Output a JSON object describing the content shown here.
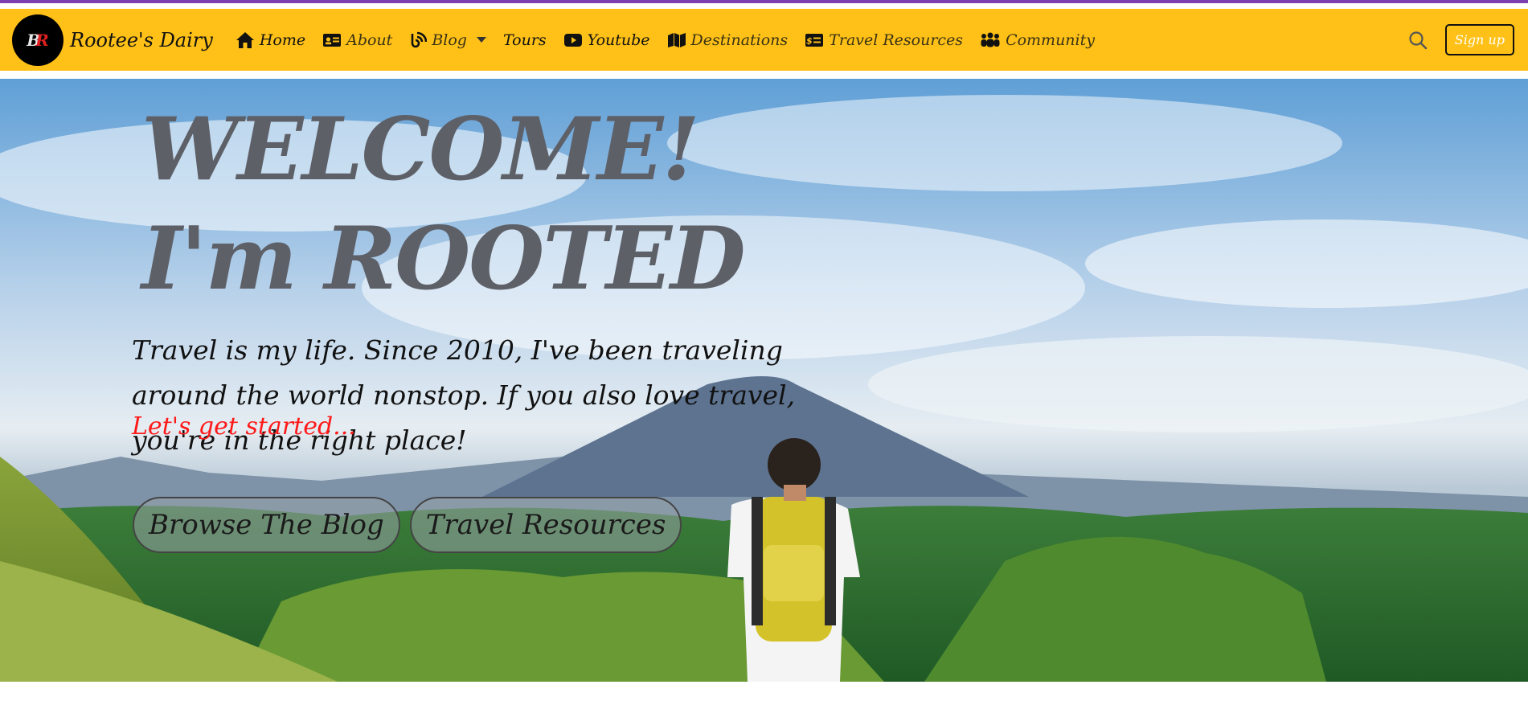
{
  "brand": {
    "logo_text_1": "B",
    "logo_text_2": "R",
    "name": "Rootee's Dairy"
  },
  "nav": {
    "items": [
      {
        "label": "Home",
        "icon": "home-icon"
      },
      {
        "label": "About",
        "icon": "id-card-icon"
      },
      {
        "label": "Blog",
        "icon": "blog-icon",
        "dropdown": true
      },
      {
        "label": "Tours",
        "icon": ""
      },
      {
        "label": "Youtube",
        "icon": "youtube-icon"
      },
      {
        "label": "Destinations",
        "icon": "map-icon"
      },
      {
        "label": "Travel Resources",
        "icon": "money-card-icon"
      },
      {
        "label": "Community",
        "icon": "users-icon"
      }
    ],
    "search_icon": "search-icon",
    "signup_label": "Sign up"
  },
  "hero": {
    "title_line_1": "WELCOME!",
    "title_line_2": "I'm ROOTED",
    "text": "Travel is my life. Since 2010, I've been traveling around the world nonstop. If you also love travel, you're in the right place!",
    "cta_text": "Let's get started...",
    "buttons": {
      "blog": "Browse The Blog",
      "resources": "Travel Resources"
    }
  },
  "colors": {
    "navbar": "#ffc117",
    "top_line": "#7b3fb0",
    "cta": "#ff1a1a",
    "title": "#5e6068"
  }
}
